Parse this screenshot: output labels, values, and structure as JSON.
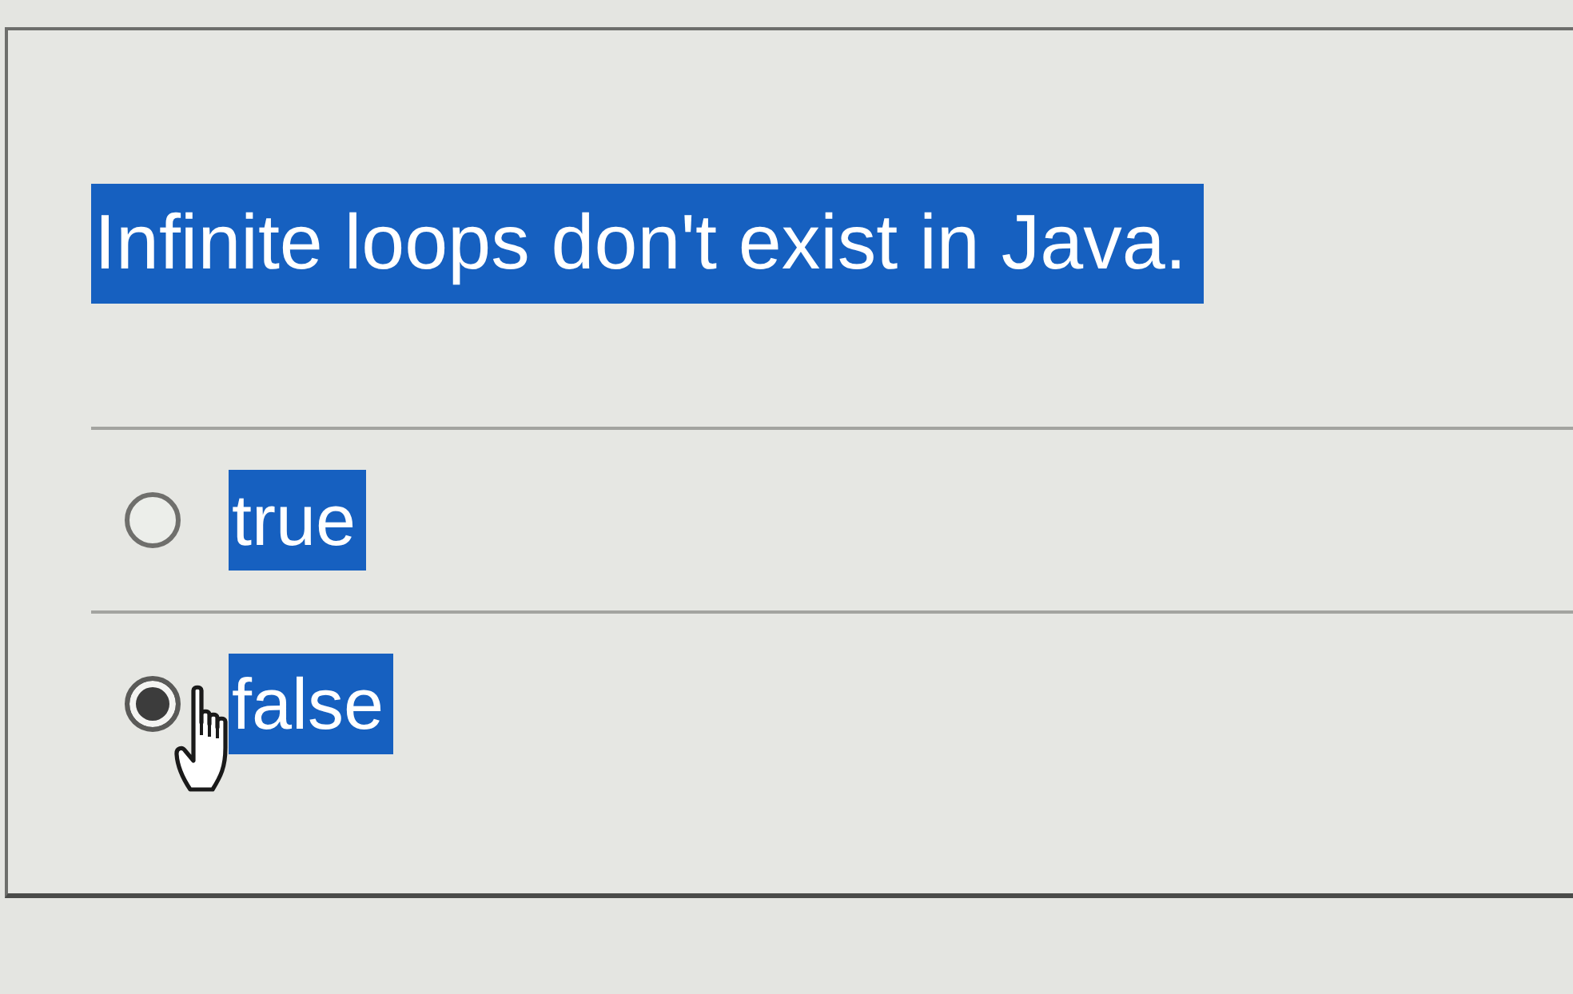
{
  "question": {
    "text": "Infinite loops don't exist in Java.",
    "highlighted": true
  },
  "options": [
    {
      "label": "true",
      "selected": false,
      "highlighted": true
    },
    {
      "label": "false",
      "selected": true,
      "highlighted": true
    }
  ]
}
